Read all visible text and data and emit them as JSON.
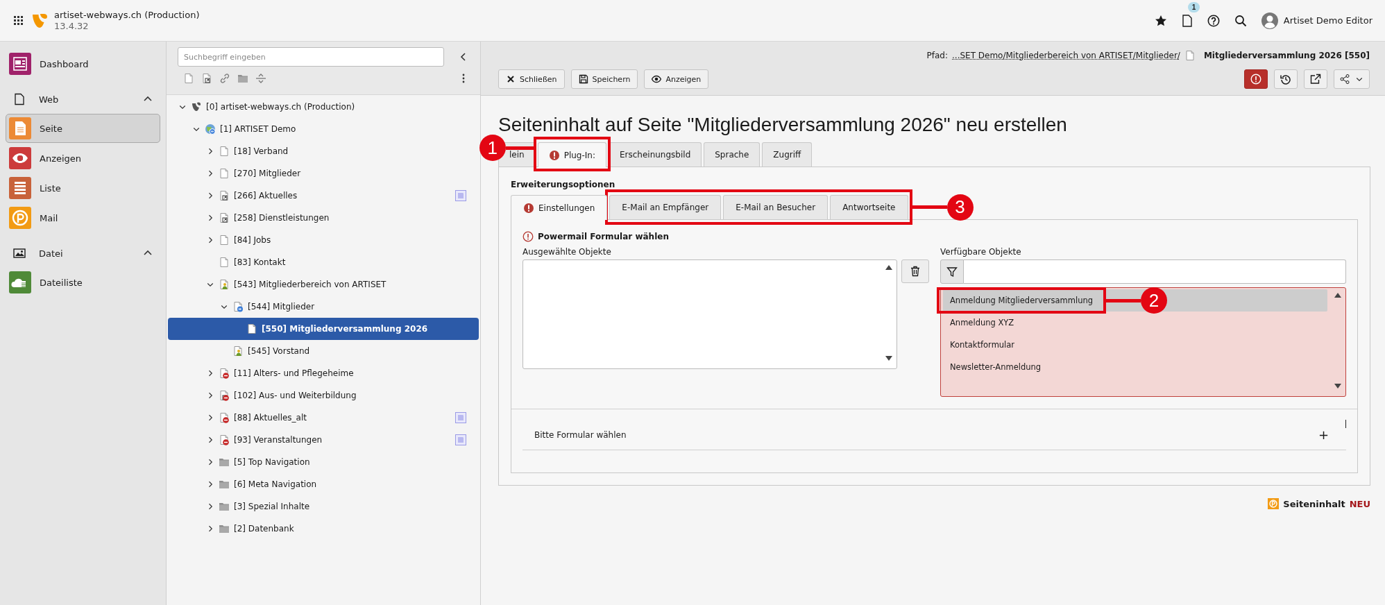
{
  "topbar": {
    "site_name": "artiset-webways.ch (Production)",
    "version": "13.4.32",
    "notification_count": "1",
    "user": "Artiset Demo Editor"
  },
  "module_menu": {
    "modules": [
      {
        "label": "Dashboard",
        "color": "#a0226a",
        "selected": false
      }
    ],
    "groups": [
      {
        "label": "Web",
        "expanded": true,
        "modules": [
          {
            "label": "Seite",
            "color": "#ec8a35",
            "selected": true
          },
          {
            "label": "Anzeigen",
            "color": "#cc3b3b",
            "selected": false
          },
          {
            "label": "Liste",
            "color": "#c8623a",
            "selected": false
          },
          {
            "label": "Mail",
            "color": "#f29b14",
            "selected": false
          }
        ]
      },
      {
        "label": "Datei",
        "expanded": true,
        "modules": [
          {
            "label": "Dateiliste",
            "color": "#4f8a38",
            "selected": false
          }
        ]
      }
    ]
  },
  "page_tree": {
    "search_placeholder": "Suchbegriff eingeben",
    "nodes": [
      {
        "label": "[0] artiset-webways.ch (Production)",
        "kind": "root",
        "expandable": true,
        "expanded": true,
        "selected": false,
        "has_badge": false,
        "children": [
          {
            "label": "[1] ARTISET Demo",
            "kind": "site",
            "expandable": true,
            "expanded": true,
            "selected": false,
            "has_badge": false,
            "children": [
              {
                "label": "[18] Verband",
                "kind": "page",
                "expandable": true,
                "expanded": false,
                "selected": false,
                "has_badge": false
              },
              {
                "label": "[270] Mitglieder",
                "kind": "page",
                "expandable": true,
                "expanded": false,
                "selected": false,
                "has_badge": false
              },
              {
                "label": "[266] Aktuelles",
                "kind": "shortcut",
                "expandable": true,
                "expanded": false,
                "selected": false,
                "has_badge": true
              },
              {
                "label": "[258] Dienstleistungen",
                "kind": "shortcut",
                "expandable": true,
                "expanded": false,
                "selected": false,
                "has_badge": false
              },
              {
                "label": "[84] Jobs",
                "kind": "page",
                "expandable": true,
                "expanded": false,
                "selected": false,
                "has_badge": false
              },
              {
                "label": "[83] Kontakt",
                "kind": "page",
                "expandable": false,
                "selected": false,
                "has_badge": false
              },
              {
                "label": "[543] Mitgliederbereich von ARTISET",
                "kind": "restricted",
                "expandable": true,
                "expanded": true,
                "selected": false,
                "has_badge": false,
                "children": [
                  {
                    "label": "[544] Mitglieder",
                    "kind": "mountpoint",
                    "expandable": true,
                    "expanded": true,
                    "selected": false,
                    "has_badge": false,
                    "children": [
                      {
                        "label": "[550] Mitgliederversammlung 2026",
                        "kind": "page",
                        "expandable": false,
                        "selected": true,
                        "has_badge": false
                      }
                    ]
                  },
                  {
                    "label": "[545] Vorstand",
                    "kind": "restricted",
                    "expandable": false,
                    "selected": false,
                    "has_badge": false
                  }
                ]
              },
              {
                "label": "[11] Alters- und Pflegeheime",
                "kind": "hidden",
                "expandable": true,
                "expanded": false,
                "selected": false,
                "has_badge": false
              },
              {
                "label": "[102] Aus- und Weiterbildung",
                "kind": "hidden-shortcut",
                "expandable": true,
                "expanded": false,
                "selected": false,
                "has_badge": false
              },
              {
                "label": "[88] Aktuelles_alt",
                "kind": "hidden",
                "expandable": true,
                "expanded": false,
                "selected": false,
                "has_badge": true
              },
              {
                "label": "[93] Veranstaltungen",
                "kind": "hidden",
                "expandable": true,
                "expanded": false,
                "selected": false,
                "has_badge": true
              },
              {
                "label": "[5] Top Navigation",
                "kind": "folder",
                "expandable": true,
                "expanded": false,
                "selected": false,
                "has_badge": false
              },
              {
                "label": "[6] Meta Navigation",
                "kind": "folder",
                "expandable": true,
                "expanded": false,
                "selected": false,
                "has_badge": false
              },
              {
                "label": "[3] Spezial Inhalte",
                "kind": "folder",
                "expandable": true,
                "expanded": false,
                "selected": false,
                "has_badge": false
              },
              {
                "label": "[2] Datenbank",
                "kind": "folder",
                "expandable": true,
                "expanded": false,
                "selected": false,
                "has_badge": false
              }
            ]
          }
        ]
      }
    ]
  },
  "docheader": {
    "path_label": "Pfad:",
    "path": "...SET Demo/Mitgliederbereich von ARTISET/Mitglieder/",
    "page_title": "Mitgliederversammlung 2026 [550]",
    "buttons": [
      {
        "label": "Schließen",
        "kind": "close"
      },
      {
        "label": "Speichern",
        "kind": "save"
      },
      {
        "label": "Anzeigen",
        "kind": "view"
      }
    ],
    "actions": [
      {
        "kind": "error"
      },
      {
        "kind": "history"
      },
      {
        "kind": "open"
      },
      {
        "kind": "share"
      }
    ]
  },
  "form": {
    "title": "Seiteninhalt auf Seite \"Mitgliederversammlung 2026\" neu erstellen",
    "tabs": [
      {
        "label": "lein",
        "selected": false,
        "error": false
      },
      {
        "label": "Plug-In:",
        "selected": true,
        "error": true,
        "callout": "1"
      },
      {
        "label": "Erscheinungsbild",
        "selected": false,
        "error": false
      },
      {
        "label": "Sprache",
        "selected": false,
        "error": false
      },
      {
        "label": "Zugriff",
        "selected": false,
        "error": false
      }
    ],
    "section_title": "Erweiterungsoptionen",
    "subtab_groups": [
      {
        "tabs": [
          {
            "label": "Einstellungen",
            "selected": true,
            "error": true
          }
        ]
      },
      {
        "callout": "3",
        "tabs": [
          {
            "label": "E-Mail an Empfänger",
            "selected": false,
            "error": false
          },
          {
            "label": "E-Mail an Besucher",
            "selected": false,
            "error": false
          },
          {
            "label": "Antwortseite",
            "selected": false,
            "error": false
          }
        ]
      }
    ],
    "field": {
      "label": "Powermail Formular wählen",
      "invalid": true,
      "selected_label": "Ausgewählte Objekte",
      "available_label": "Verfügbare Objekte",
      "available": [
        {
          "label": "Anmeldung Mitgliederversammlung",
          "selected": true,
          "callout": "2"
        },
        {
          "label": "Anmeldung XYZ",
          "selected": false
        },
        {
          "label": "Kontaktformular",
          "selected": false
        },
        {
          "label": "Newsletter-Anmeldung",
          "selected": false
        }
      ]
    },
    "collapsible": {
      "label": "Bitte Formular wählen",
      "toggle_symbol": "+"
    }
  },
  "footer": {
    "label": "Seiteninhalt",
    "tag": "NEU"
  }
}
